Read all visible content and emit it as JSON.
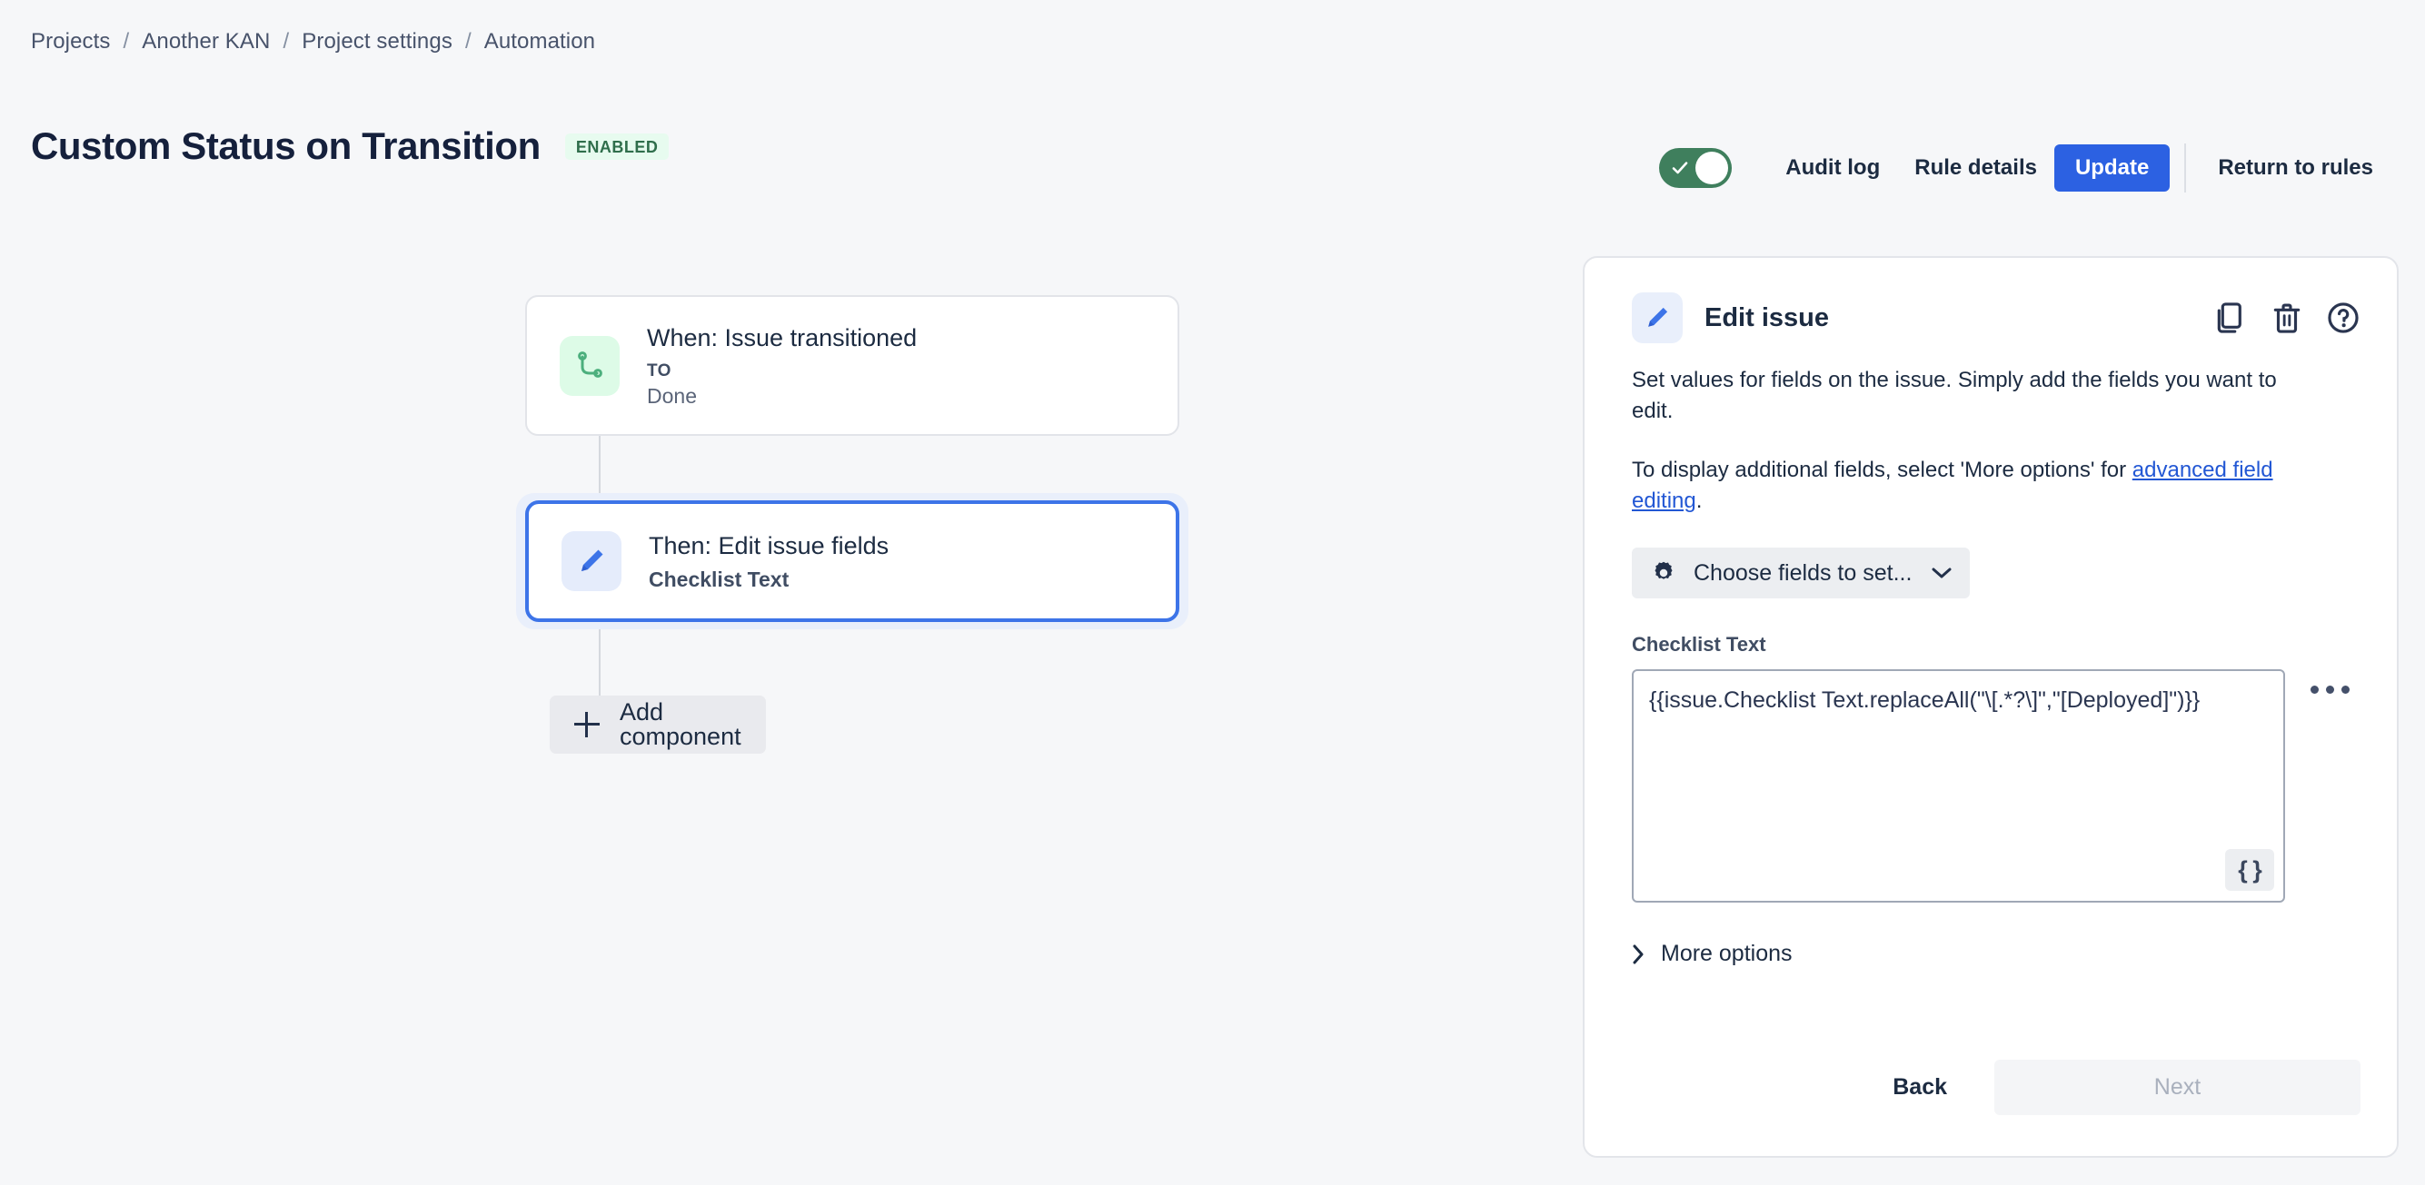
{
  "breadcrumb": {
    "items": [
      "Projects",
      "Another KAN",
      "Project settings",
      "Automation"
    ],
    "separator": "/"
  },
  "header": {
    "title": "Custom Status on Transition",
    "status_badge": "ENABLED",
    "toggle_on": true,
    "actions": {
      "audit_log": "Audit log",
      "rule_details": "Rule details",
      "update": "Update",
      "return_to_rules": "Return to rules"
    }
  },
  "workflow": {
    "nodes": [
      {
        "icon": "transition-icon",
        "title": "When: Issue transitioned",
        "sub_label": "TO",
        "sub_value": "Done"
      },
      {
        "icon": "pencil-icon",
        "title": "Then: Edit issue fields",
        "sub_strong": "Checklist Text"
      }
    ],
    "add_component_label": "Add component"
  },
  "panel": {
    "title": "Edit issue",
    "icon": "pencil-icon",
    "head_actions": [
      "copy-icon",
      "trash-icon",
      "help-icon"
    ],
    "description_1": "Set values for fields on the issue. Simply add the fields you want to edit.",
    "description_2_prefix": "To display additional fields, select 'More options' for ",
    "description_2_link": "advanced field editing",
    "description_2_suffix": ".",
    "choose_fields_label": "Choose fields to set...",
    "field_label": "Checklist Text",
    "field_value": "{{issue.Checklist Text.replaceAll(\"\\[.*?\\]\",\"[Deployed]\")}}",
    "smart_values_button": "{ }",
    "more_options_label": "More options",
    "back_label": "Back",
    "next_label": "Next"
  },
  "colors": {
    "accent_blue": "#2c61e2",
    "selected_border": "#3d74e8",
    "toggle_green": "#3f7f5d",
    "badge_bg": "#e7fbef",
    "badge_text": "#2f6e4b",
    "page_bg": "#f6f7f9",
    "link": "#2257d4"
  }
}
